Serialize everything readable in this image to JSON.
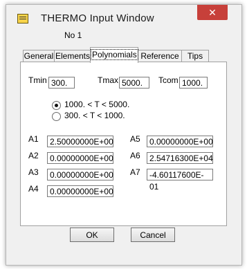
{
  "window": {
    "title": "THERMO  Input Window",
    "close_glyph": "✕",
    "icon": "app-icon"
  },
  "record": "No 1",
  "tabs": [
    "General",
    "Elements",
    "Polynomials",
    "Reference",
    "Tips"
  ],
  "active_tab": "Polynomials",
  "temps": {
    "tmin": {
      "label": "Tmin",
      "value": "300."
    },
    "tmax": {
      "label": "Tmax",
      "value": "5000."
    },
    "tcom": {
      "label": "Tcom",
      "value": "1000."
    }
  },
  "range": {
    "options": [
      "1000. < T < 5000.",
      "300. < T < 1000."
    ],
    "selected_index": 0
  },
  "coefficients": [
    {
      "label": "A1",
      "value": "2.50000000E+00"
    },
    {
      "label": "A2",
      "value": "0.00000000E+00"
    },
    {
      "label": "A3",
      "value": "0.00000000E+00"
    },
    {
      "label": "A4",
      "value": "0.00000000E+00"
    },
    {
      "label": "A5",
      "value": "0.00000000E+00"
    },
    {
      "label": "A6",
      "value": "2.54716300E+04"
    },
    {
      "label": "A7",
      "value": "-4.60117600E-01"
    }
  ],
  "buttons": {
    "ok": "OK",
    "cancel": "Cancel"
  }
}
